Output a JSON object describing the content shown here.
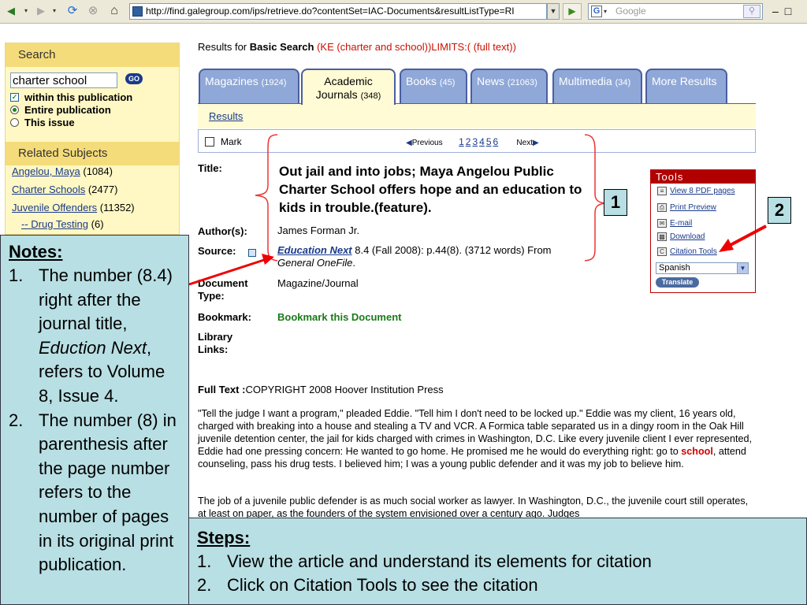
{
  "browser": {
    "url": "http://find.galegroup.com/ips/retrieve.do?contentSet=IAC-Documents&resultListType=RI",
    "search_placeholder": "Google",
    "search_engine_glyph": "G"
  },
  "sidebar": {
    "search_heading": "Search",
    "search_value": "charter school",
    "go_label": "GO",
    "options": [
      "within this publication",
      "Entire publication",
      "This issue"
    ],
    "related_heading": "Related Subjects",
    "related": [
      {
        "label": "Angelou, Maya",
        "count": "(1084)"
      },
      {
        "label": "Charter Schools",
        "count": "(2477)"
      },
      {
        "label": "Juvenile Offenders",
        "count": "(11352)"
      },
      {
        "label": "-- Drug Testing",
        "count": "(6)"
      }
    ]
  },
  "header": {
    "results_for": "Results for",
    "search_type": "Basic Search",
    "query": "(KE (charter and school))LIMITS:( (full text))"
  },
  "tabs": [
    {
      "label": "Magazines",
      "count": "(1924)"
    },
    {
      "label": "Academic",
      "label2": "Journals",
      "count": "(348)"
    },
    {
      "label": "Books",
      "count": "(45)"
    },
    {
      "label": "News",
      "count": "(21063)"
    },
    {
      "label": "Multimedia",
      "count": "(34)"
    },
    {
      "label": "More Results",
      "count": ""
    }
  ],
  "results_link": "Results",
  "nav": {
    "mark": "Mark",
    "previous": "Previous",
    "pages": [
      "1",
      "2",
      "3",
      "4",
      "5",
      "6"
    ],
    "next": "Next"
  },
  "record": {
    "title_label": "Title:",
    "title": "Out jail and into jobs; Maya Angelou Public Charter School offers hope and an education to kids in trouble.(feature).",
    "author_label": "Author(s):",
    "author": "James Forman Jr.",
    "source_label": "Source:",
    "source_journal": "Education Next",
    "source_rest": "8.4 (Fall 2008): p.44(8). (3712 words) From",
    "source_db": "General OneFile",
    "source_end": ".",
    "doctype_label": "Document Type:",
    "doctype": "Magazine/Journal",
    "bookmark_label": "Bookmark:",
    "bookmark": "Bookmark this Document",
    "library_label": "Library Links:"
  },
  "tools": {
    "heading": "Tools",
    "items": [
      "View 8 PDF pages",
      "Print Preview",
      "E-mail",
      "Download",
      "Citation Tools"
    ],
    "language": "Spanish",
    "translate": "Translate"
  },
  "fulltext": {
    "label": "Full Text :",
    "copyright": "COPYRIGHT 2008 Hoover Institution Press",
    "para1_a": "\"Tell the judge I want a program,\" pleaded Eddie. \"Tell him I don't need to be locked up.\" Eddie was my client, 16 years old, charged with breaking into a house and stealing a TV and VCR. A Formica table separated us in a dingy room in the Oak Hill juvenile detention center, the jail for kids charged with crimes in Washington, D.C. Like every juvenile client I ever represented, Eddie had one pressing concern: He wanted to go home. He promised me he would do everything right: go to",
    "para1_hl": "school",
    "para1_b": ", attend counseling, pass his drug tests. I believed him; I was a young public defender and it was my job to believe him.",
    "para2": "The job of a juvenile public defender is as much social worker as lawyer. In Washington, D.C., the juvenile court still operates, at least on paper, as the founders of the system envisioned over a century ago. Judges"
  },
  "notes": {
    "heading": "Notes:",
    "item1_a": "The number (8.4) right after the journal title,",
    "item1_em": "Eduction Next",
    "item1_b": ", refers to Volume 8, Issue 4.",
    "item2": "The number (8) in parenthesis after the page number refers to the number of pages in its original print publication."
  },
  "steps": {
    "heading": "Steps:",
    "items": [
      "View the article and understand its elements for citation",
      "Click on Citation Tools to see the citation"
    ]
  },
  "callouts": [
    "1",
    "2"
  ],
  "colors": {
    "tab": "#8fa8d8",
    "tab_active": "#fffbd4",
    "notes_bg": "#b8dfe4",
    "arrow": "#ee0000",
    "tools_border": "#b00000"
  }
}
